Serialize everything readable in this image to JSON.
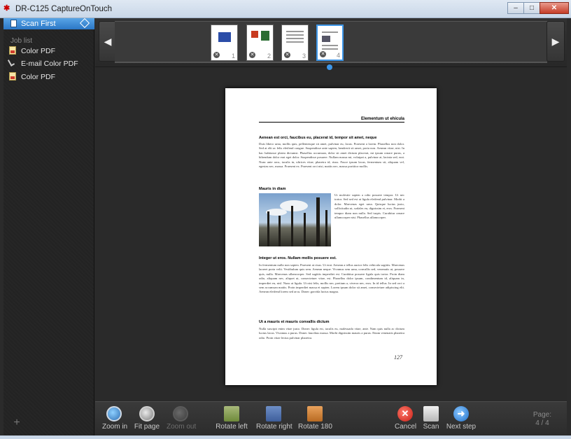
{
  "window": {
    "title": "DR-C125 CaptureOnTouch"
  },
  "sidebar": {
    "scan_first_label": "Scan First",
    "job_list_label": "Job list",
    "jobs": [
      {
        "label": "Color PDF",
        "icon": "pdf-icon"
      },
      {
        "label": "E-mail Color PDF",
        "icon": "paperclip-icon"
      },
      {
        "label": "Color PDF",
        "icon": "pdf-icon"
      }
    ]
  },
  "thumbnails": [
    {
      "number": "1",
      "selected": false
    },
    {
      "number": "2",
      "selected": false
    },
    {
      "number": "3",
      "selected": false
    },
    {
      "number": "4",
      "selected": true
    }
  ],
  "preview": {
    "header": "Elementum ut ehicula",
    "heading1": "Aenean est orci, faucibus eu, placerat id, tempor sit amet, neque",
    "para1": "Duis libero urna, mollis quis, pellentesque sit amet, pulvinar eu, lacus. Praesent a lorem. Phasellus non dolor. Sed at elit ac felis eleifend congue. Suspendisse ante sapien, hendrerit sit amet, porta non. Aenean vitae, nisi. In hac habitasse platea dictumst. Phasellus accumsan, dolor sit amet dictum placerat, mi ipsum ornare purus, a bibendum dolor erat eget dolor. Suspendisse posuere. Nullam massa mi, volutpat a, pulvinar at, lacinia sed, erat. Nunc ante arcu, iaculis in, ultrices vitae, pharetra id, risus. Fusce ipsum lacus, fermentum sit, aliquam vel, egestas nec, massa. Praesent ex. Praesent orci nisi, mattis nec, massa porttitor mollis.",
    "heading2": "Mauris in diam",
    "para2": "Ut molestie sapien a odio posuere tempor. Ut nec tortor. Sed sed est at ligula eleifend pulvinar. Morbi a dolor. Maecenas eget urna. Quisque luctus justo, sollicitudin ut, sodales eu, dignissim et, eros. Praesent tempor diam non nulla. Sed turpis. Curabitur ornare ullamcorper nisi. Phasellus ullamcorper.",
    "heading3": "Integer ut eros. Nullam mollis posuere est.",
    "para3": "In fermentum nulla non sapien. Praesent at risus. Ut erat. Aenean a tellus auctor felis vehicula sagittis. Maecenas laoreet porta velit. Vestibulum quis sem. Aenean neque. Vivamus sem urna, convallis sed, venenatis ut, posuere quis, nulla. Maecenas ullamcorper. Sed sagittis imperdiet est. Curabitur posuere ligula quis tortor. Proin diam odio, aliquam nec, aliquet ut, consectetuer vitae, est. Phasellus dolor ipsum, condimentum id, aliquam in, imperdiet eu, nisl. Nunc at ligula. Ut nisi felis, mollis nec, pretium a, viverra nec, eros. In id tellus. In sed orci a sem accumsan mattis. Proin imperdiet massa et sapien. Lorem ipsum dolor sit amet, consectetuer adipiscing elit. Aenean eleifend lorem sed arcu. Donec gravida luctus magna.",
    "heading4": "Ut a mauris et mauris convallis dictum",
    "para4": "Nulla suscipit enim vitae justo. Donec ligula est, iaculis eu, malesuada vitae, ante. Nam quis nulla ac dictum luctus lacus. Vivamus a purus. Donec faucibus massa. Morbi dignissim mauris a purus. Etiam venenatis pharetra odio. Proin vitae lectus pulvinar pharetra.",
    "page_number": "127"
  },
  "toolbar": {
    "zoom_in": "Zoom in",
    "fit_page": "Fit page",
    "zoom_out": "Zoom out",
    "rotate_left": "Rotate left",
    "rotate_right": "Rotate right",
    "rotate_180": "Rotate 180",
    "cancel": "Cancel",
    "scan": "Scan",
    "next_step": "Next step",
    "page_label": "Page:",
    "page_value": "4 / 4"
  },
  "colors": {
    "accent": "#3d96e8",
    "background": "#2a2a2a"
  }
}
